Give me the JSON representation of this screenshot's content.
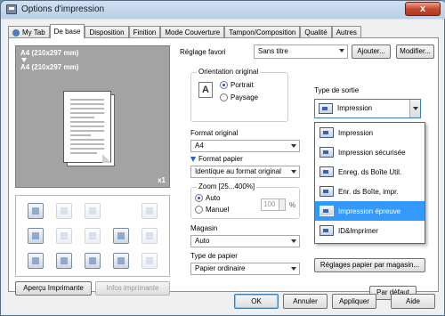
{
  "window": {
    "title": "Options d'impression",
    "close_label": "x"
  },
  "tabs": [
    {
      "label": "My Tab",
      "icon": "my-tab-icon"
    },
    {
      "label": "De base"
    },
    {
      "label": "Disposition"
    },
    {
      "label": "Finition"
    },
    {
      "label": "Mode Couverture"
    },
    {
      "label": "Tampon/Composition"
    },
    {
      "label": "Qualité"
    },
    {
      "label": "Autres"
    }
  ],
  "preview": {
    "size_line1": "A4 (210x297 mm)",
    "size_line2": "A4 (210x297 mm)",
    "count": "x1"
  },
  "left_buttons": {
    "preview_printer": "Aperçu Imprimante",
    "printer_info": "Infos imprimante"
  },
  "favorite": {
    "label": "Réglage favori",
    "value": "Sans titre",
    "add": "Ajouter...",
    "modify": "Modifier..."
  },
  "orientation": {
    "title": "Orientation original",
    "portrait": "Portrait",
    "landscape": "Paysage",
    "selected": "Portrait",
    "icon_letter": "A"
  },
  "format_original": {
    "label": "Format original",
    "value": "A4"
  },
  "format_papier": {
    "label": "Format papier",
    "value": "Identique au format original"
  },
  "zoom": {
    "title": "Zoom [25...400%]",
    "auto": "Auto",
    "manual": "Manuel",
    "value": "100",
    "unit": "%"
  },
  "magasin": {
    "label": "Magasin",
    "value": "Auto"
  },
  "type_papier": {
    "label": "Type de papier",
    "value": "Papier ordinaire"
  },
  "output_type": {
    "label": "Type de sortie",
    "value": "Impression",
    "options": [
      "Impression",
      "Impression sécurisée",
      "Enreg. ds Boîte Util.",
      "Enr. ds Boîte, impr.",
      "Impression épreuve",
      "ID&Imprimer"
    ],
    "highlighted": "Impression épreuve"
  },
  "paper_settings_button": "Réglages papier par magasin...",
  "default_button": "Par défaut",
  "footer": {
    "ok": "OK",
    "cancel": "Annuler",
    "apply": "Appliquer",
    "help": "Aide"
  }
}
